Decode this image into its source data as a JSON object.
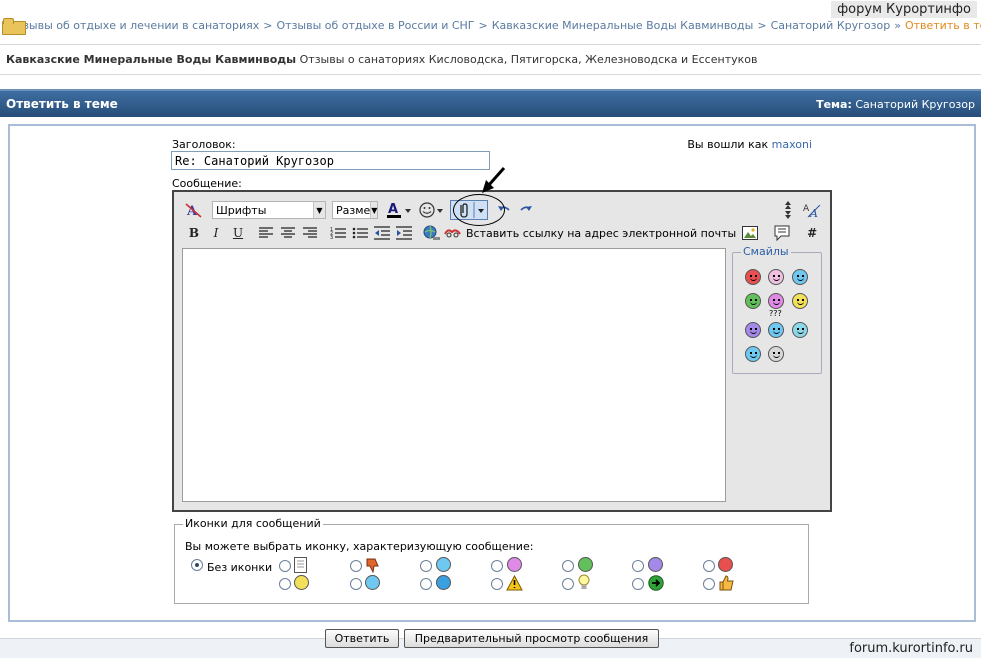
{
  "watermark": {
    "top": "форум Курортинфо",
    "bottom": "forum.kurortinfo.ru"
  },
  "breadcrumb": {
    "items": [
      "Отзывы об отдыхе и лечении в санаториях",
      "Отзывы об отдыхе в России и СНГ",
      "Кавказские Минеральные Воды Кавминводы",
      "Санаторий Кругозор"
    ],
    "current": "Ответить в теме",
    "sep": ">",
    "last_sep": "»"
  },
  "forum": {
    "name": "Кавказские Минеральные Воды Кавминводы",
    "description": "Отзывы о санаториях Кисловодска, Пятигорска, Железноводска и Ессентуков"
  },
  "header": {
    "title": "Ответить в теме",
    "topic_label": "Тема:",
    "topic_value": "Санаторий Кругозор"
  },
  "form": {
    "subject_label": "Заголовок:",
    "subject_value": "Re: Санаторий Кругозор",
    "message_label": "Сообщение:",
    "logged_in_text": "Вы вошли как",
    "username": "maxoni"
  },
  "toolbar": {
    "font_select": "Шрифты",
    "size_select": "Разме",
    "insert_email_label": "Вставить ссылку на адрес электронной почты",
    "hash_label": "#"
  },
  "smilies": {
    "legend": "Смайлы",
    "question_mark_text": "???"
  },
  "message_icons": {
    "legend": "Иконки для сообщений",
    "hint": "Вы можете выбрать иконку, характеризующую сообщение:",
    "no_icon_label": "Без иконки"
  },
  "buttons": {
    "reply": "Ответить",
    "preview": "Предварительный просмотр сообщения"
  }
}
